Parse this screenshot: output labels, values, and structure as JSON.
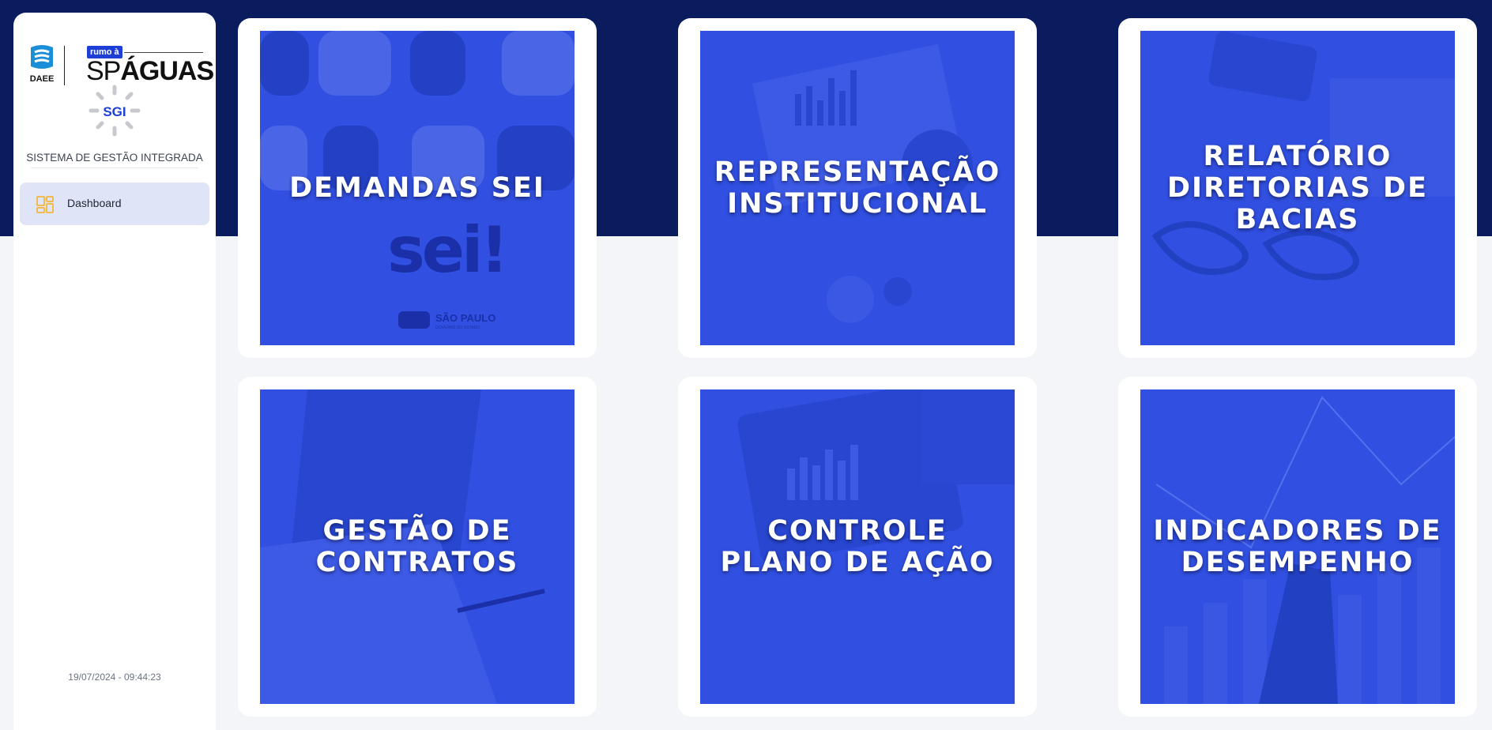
{
  "colors": {
    "header_band": "#0b1c5e",
    "tile_blue": "#3150e2",
    "nav_active_bg": "#dfe4f7",
    "nav_icon": "#f2b53a",
    "brand_blue": "#1d3fd6"
  },
  "sidebar": {
    "logo": {
      "daee_text": "DAEE",
      "badge_text": "rumo à",
      "brand_sp": "SP",
      "brand_aguas": "ÁGUAS"
    },
    "sgi_logo_text": "SGI",
    "system_title": "SISTEMA DE GESTÃO INTEGRADA",
    "nav": [
      {
        "label": "Dashboard",
        "icon": "dashboard-grid-icon",
        "active": true
      }
    ],
    "timestamp": "19/07/2024 - 09:44:23"
  },
  "cards": [
    {
      "title": "DEMANDAS SEI",
      "sei_logo_text": "sei!",
      "gov_text": "SÃO PAULO",
      "gov_subtext": "GOVERNO DO ESTADO"
    },
    {
      "title": "REPRESENTAÇÃO\nINSTITUCIONAL"
    },
    {
      "title": "RELATÓRIO\nDIRETORIAS DE\nBACIAS"
    },
    {
      "title": "GESTÃO DE\nCONTRATOS"
    },
    {
      "title": "CONTROLE\nPLANO DE AÇÃO"
    },
    {
      "title": "INDICADORES DE\nDESEMPENHO"
    }
  ]
}
